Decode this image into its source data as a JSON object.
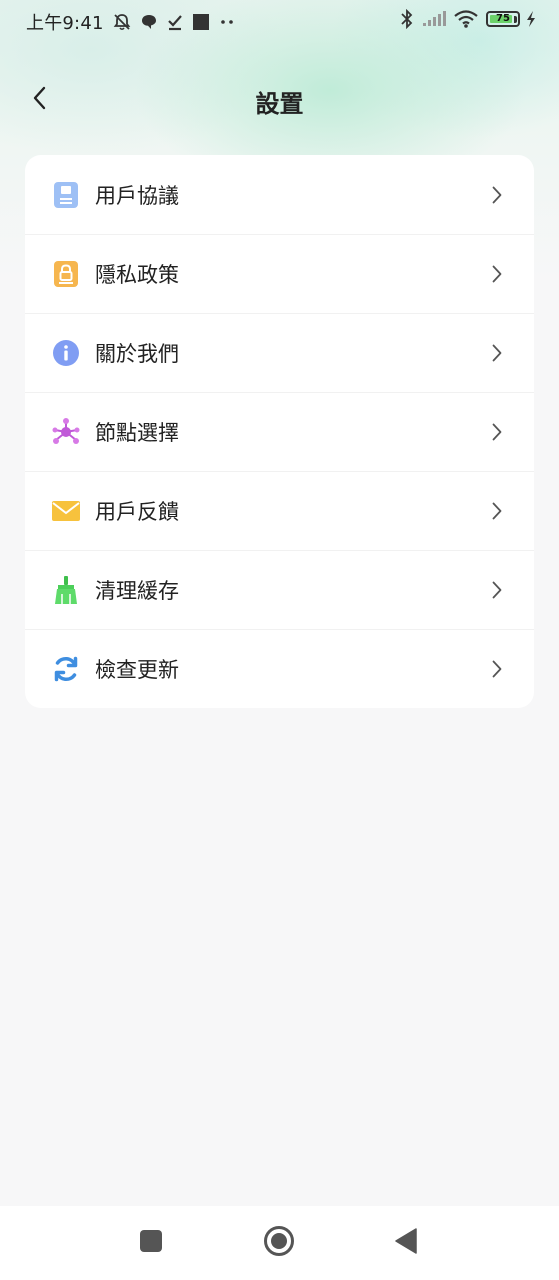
{
  "status_bar": {
    "time": "上午9:41",
    "battery_level": "75",
    "icons": [
      "mute-bell-icon",
      "chat-bubble-icon",
      "checkmark-icon",
      "square-icon",
      "more-dots-icon",
      "bluetooth-icon",
      "signal-icon",
      "wifi-icon",
      "battery-icon",
      "charging-icon"
    ]
  },
  "header": {
    "title": "設置",
    "back_icon": "chevron-left-icon"
  },
  "settings": {
    "items": [
      {
        "label": "用戶協議",
        "icon": "document-icon",
        "color": "#8fb7f3"
      },
      {
        "label": "隱私政策",
        "icon": "privacy-lock-icon",
        "color": "#f5b24f"
      },
      {
        "label": "關於我們",
        "icon": "info-icon",
        "color": "#7f9cf5"
      },
      {
        "label": "節點選擇",
        "icon": "node-network-icon",
        "color": "#c05ad8"
      },
      {
        "label": "用戶反饋",
        "icon": "mail-icon",
        "color": "#f7c23d"
      },
      {
        "label": "清理緩存",
        "icon": "broom-icon",
        "color": "#4ccf5a"
      },
      {
        "label": "檢查更新",
        "icon": "refresh-icon",
        "color": "#3f8ee0"
      }
    ]
  },
  "nav_bar": {
    "recents_icon": "square-icon",
    "home_icon": "circle-icon",
    "back_icon": "triangle-back-icon"
  }
}
